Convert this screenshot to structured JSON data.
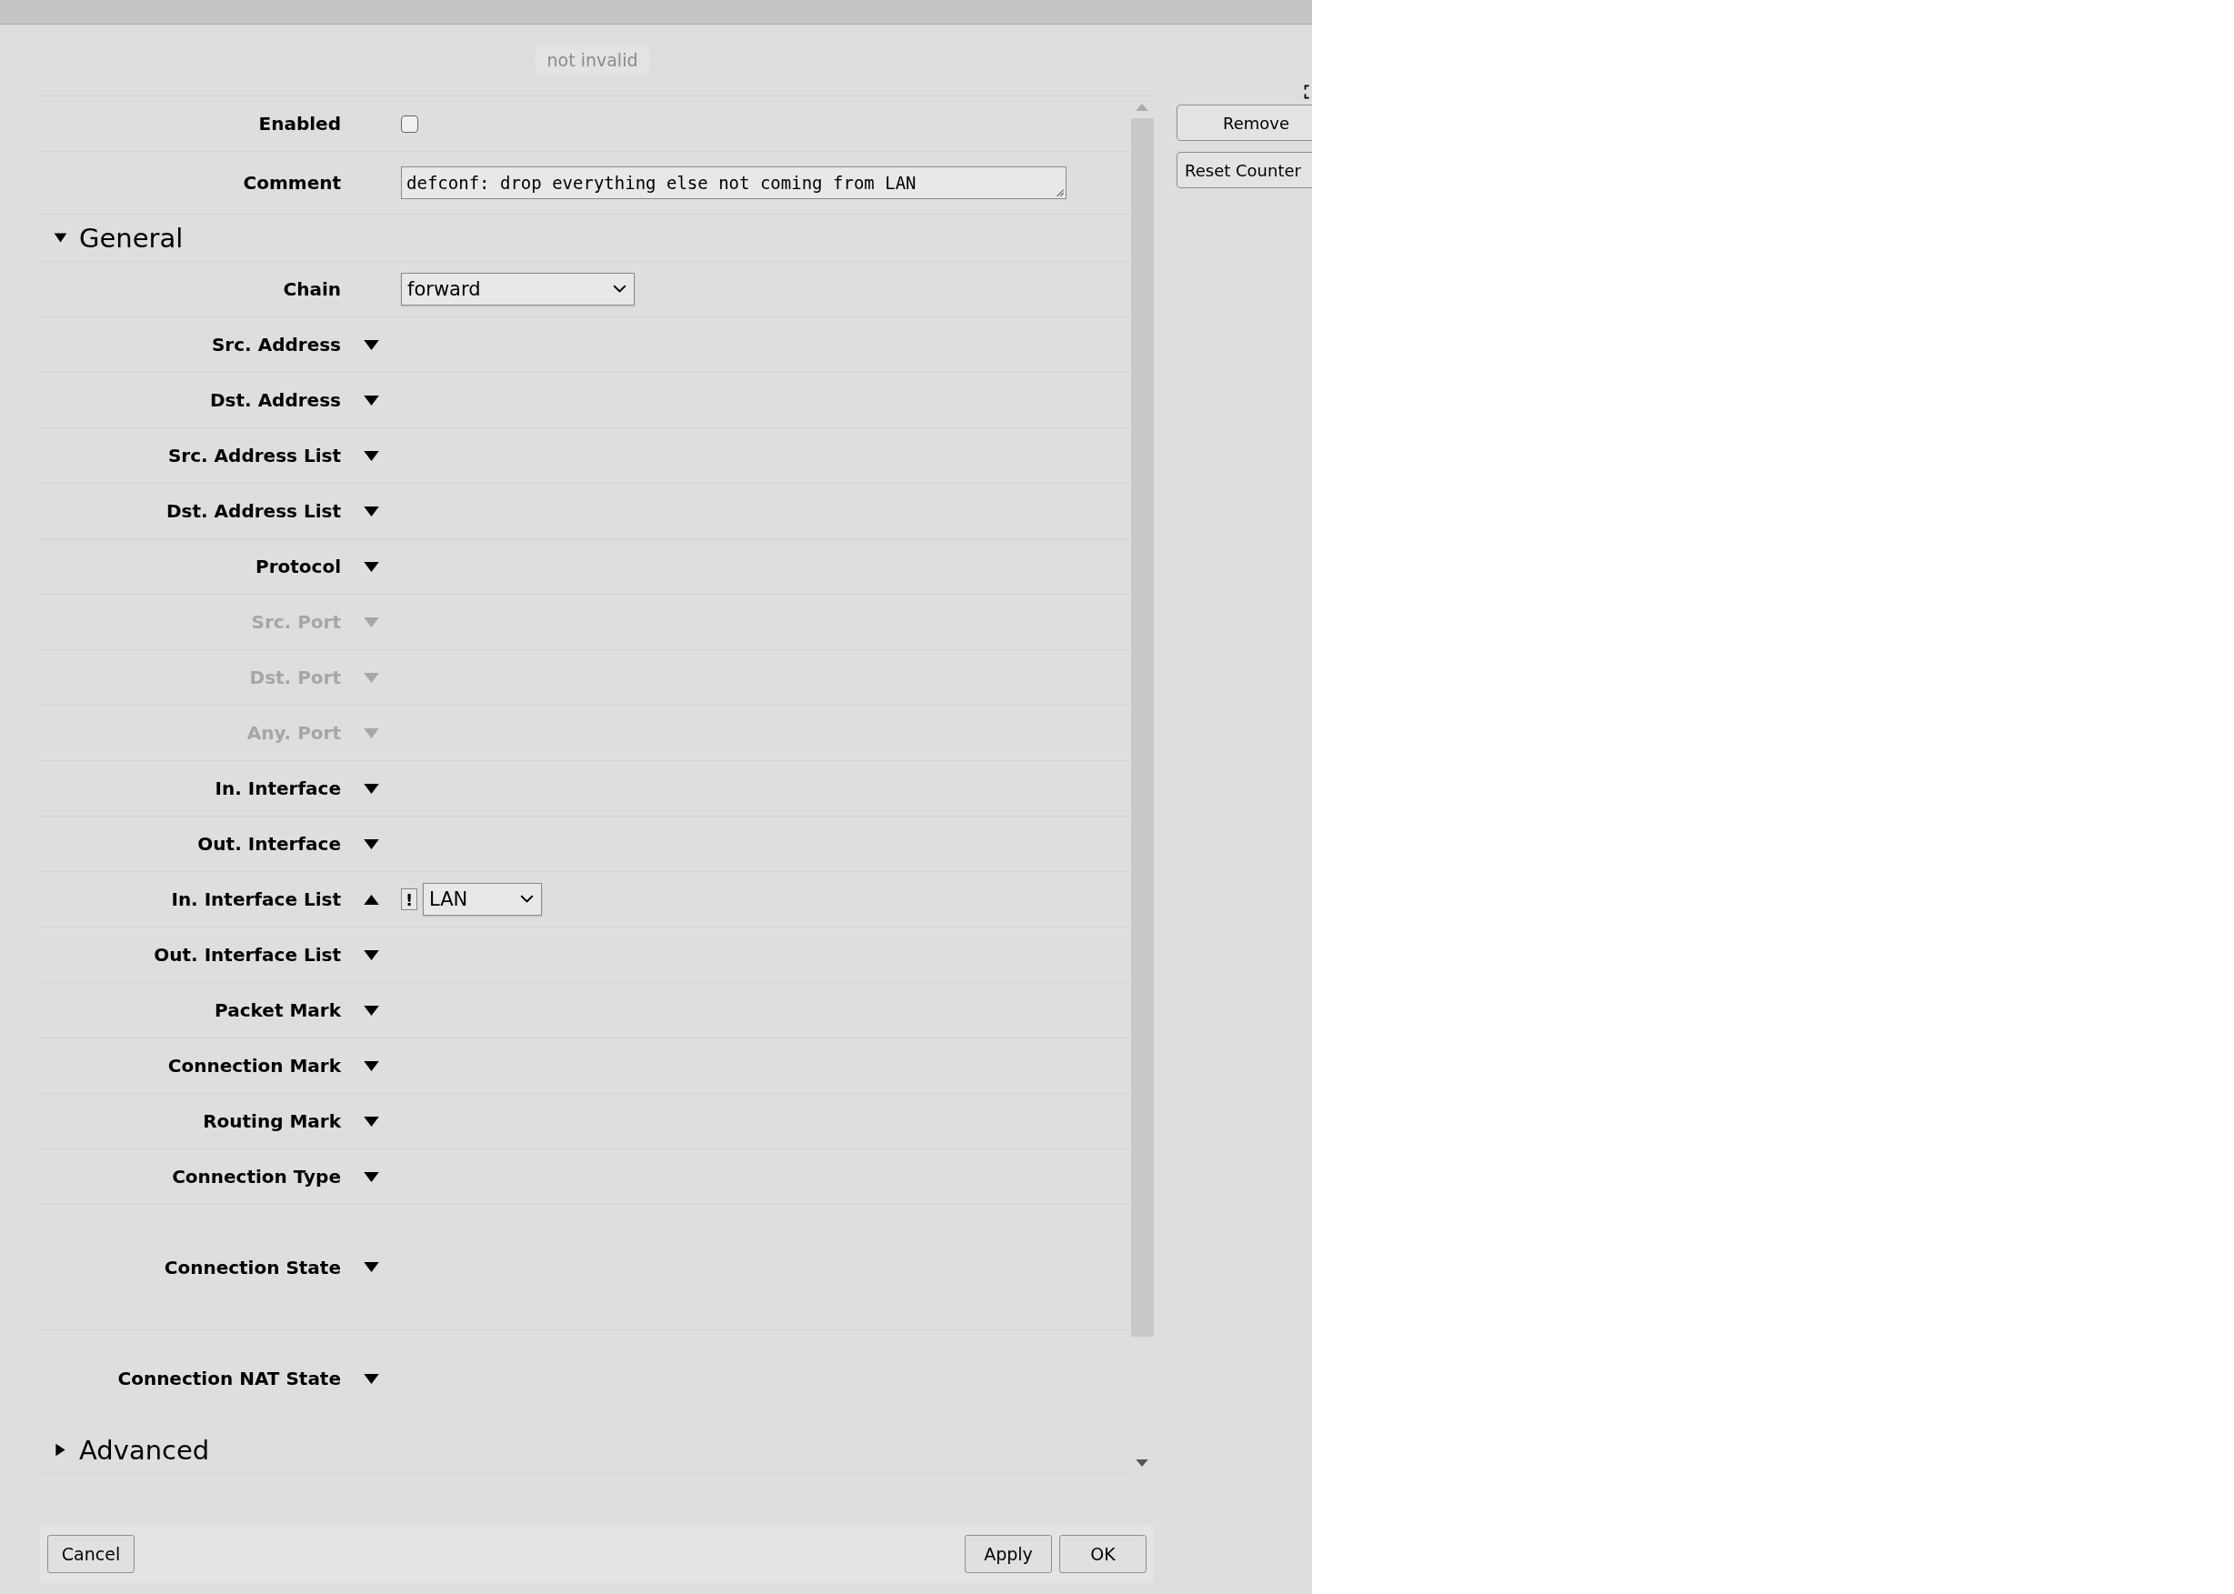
{
  "status_badge": "not invalid",
  "side_buttons": [
    "Remove",
    "Reset Counter"
  ],
  "fields": [
    {
      "label": "Enabled",
      "kind": "checkbox",
      "checked": false
    },
    {
      "label": "Comment",
      "kind": "textarea",
      "value": "defconf: drop everything else not coming from LAN"
    }
  ],
  "sections": [
    {
      "title": "General",
      "expanded": true,
      "rows": [
        {
          "label": "Chain",
          "kind": "select",
          "value": "forward"
        },
        {
          "label": "Src. Address",
          "kind": "expander",
          "expanded": false,
          "disabled": false
        },
        {
          "label": "Dst. Address",
          "kind": "expander",
          "expanded": false,
          "disabled": false
        },
        {
          "label": "Src. Address List",
          "kind": "expander",
          "expanded": false,
          "disabled": false
        },
        {
          "label": "Dst. Address List",
          "kind": "expander",
          "expanded": false,
          "disabled": false
        },
        {
          "label": "Protocol",
          "kind": "expander",
          "expanded": false,
          "disabled": false
        },
        {
          "label": "Src. Port",
          "kind": "expander",
          "expanded": false,
          "disabled": true
        },
        {
          "label": "Dst. Port",
          "kind": "expander",
          "expanded": false,
          "disabled": true
        },
        {
          "label": "Any. Port",
          "kind": "expander",
          "expanded": false,
          "disabled": true
        },
        {
          "label": "In. Interface",
          "kind": "expander",
          "expanded": false,
          "disabled": false
        },
        {
          "label": "Out. Interface",
          "kind": "expander",
          "expanded": false,
          "disabled": false
        },
        {
          "label": "In. Interface List",
          "kind": "expander",
          "expanded": true,
          "disabled": false,
          "flag": "!",
          "value": "LAN"
        },
        {
          "label": "Out. Interface List",
          "kind": "expander",
          "expanded": false,
          "disabled": false
        },
        {
          "label": "Packet Mark",
          "kind": "expander",
          "expanded": false,
          "disabled": false
        },
        {
          "label": "Connection Mark",
          "kind": "expander",
          "expanded": false,
          "disabled": false
        },
        {
          "label": "Routing Mark",
          "kind": "expander",
          "expanded": false,
          "disabled": false
        },
        {
          "label": "Connection Type",
          "kind": "expander",
          "expanded": false,
          "disabled": false
        },
        {
          "label": "Connection State",
          "kind": "expander",
          "expanded": false,
          "disabled": false
        },
        {
          "label": "Connection NAT State",
          "kind": "expander",
          "expanded": false,
          "disabled": false
        }
      ]
    },
    {
      "title": "Advanced",
      "expanded": false
    }
  ],
  "footer": {
    "left": [
      "Cancel"
    ],
    "right": [
      "Apply",
      "OK"
    ]
  }
}
